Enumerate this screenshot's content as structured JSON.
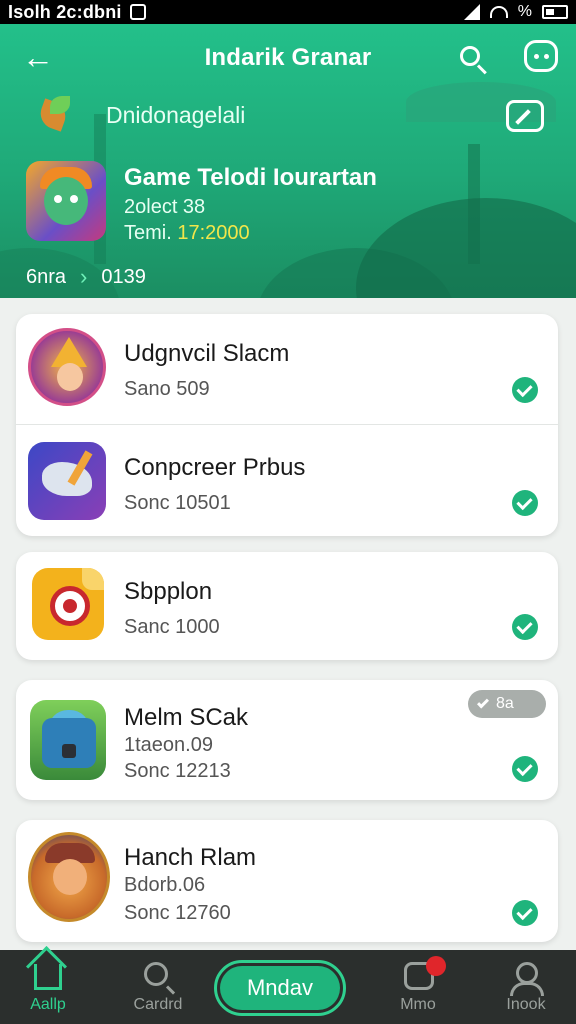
{
  "status_bar": {
    "time": "Isolh 2c:dbni",
    "battery": "%"
  },
  "header": {
    "title": "Indarik Granar",
    "subtitle": "Dnidonagelali",
    "game": {
      "name": "Game Telodi Iourartan",
      "meta1": "2olect 38",
      "meta2_prefix": "Temi. ",
      "meta2_highlight": "17:2000"
    },
    "breadcrumb": {
      "left": "6nra",
      "right": "0139"
    }
  },
  "apps": [
    {
      "name": "Udgnvcil Slacm",
      "line1": "",
      "line2": "Sano 509",
      "icon": "wizard-icon"
    },
    {
      "name": "Conpcreer Prbus",
      "line1": "",
      "line2": "Sonc 10501",
      "icon": "wolf-icon"
    },
    {
      "name": "Sbpplon",
      "line1": "",
      "line2": "Sanc 1000",
      "icon": "target-icon"
    },
    {
      "name": "Melm SCak",
      "line1": "1taeon.09",
      "line2": "Sonc 12213",
      "icon": "robot-icon",
      "pill": "8a"
    },
    {
      "name": "Hanch Rlam",
      "line1": "Bdorb.06",
      "line2": "Sonc 12760",
      "icon": "pirate-icon"
    }
  ],
  "bottom_nav": {
    "items": [
      {
        "label": "Aallp"
      },
      {
        "label": "Cardrd"
      },
      {
        "label": "Mndav"
      },
      {
        "label": "Mmo",
        "badge": ""
      },
      {
        "label": "Inook"
      }
    ]
  },
  "colors": {
    "accent": "#1fb47c",
    "header": "#23c08a",
    "nav": "#2b2f2d"
  }
}
